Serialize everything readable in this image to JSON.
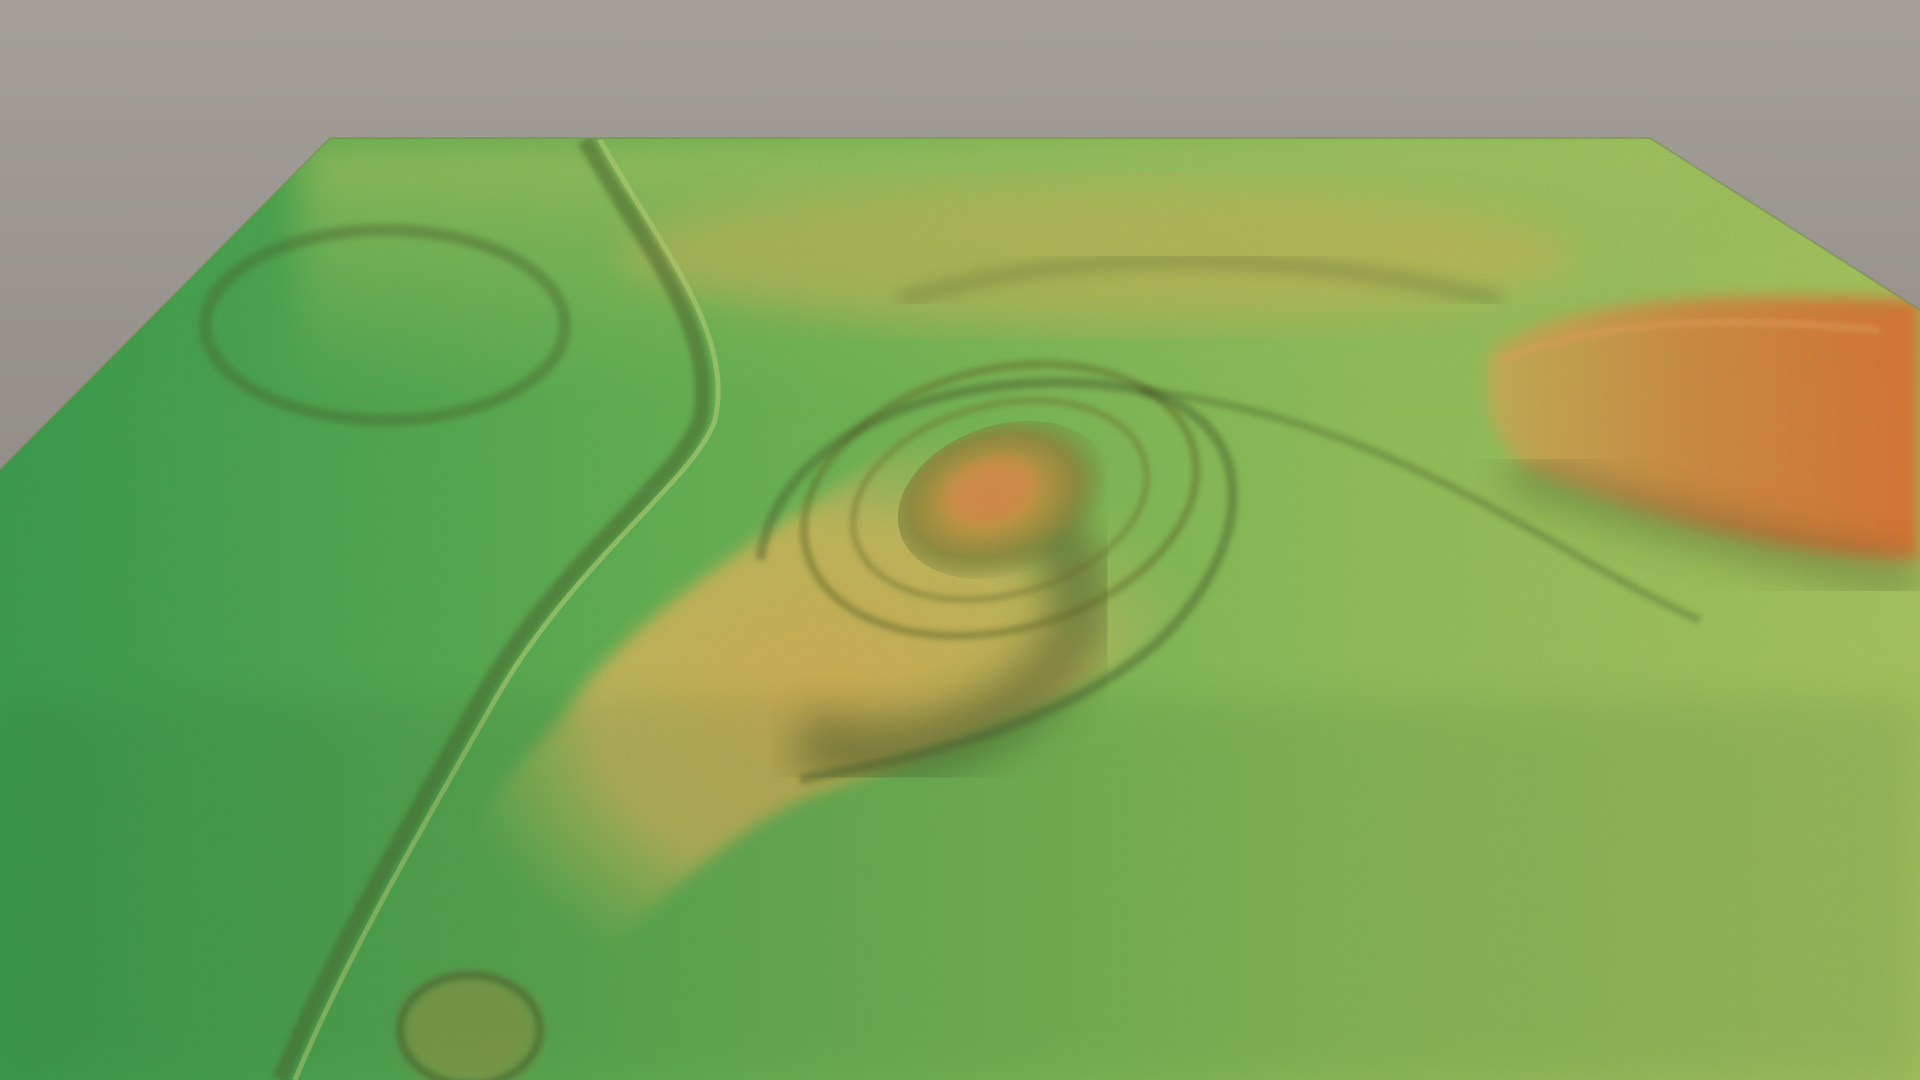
{
  "image": {
    "subject": "terrain-relief-render",
    "colors": {
      "background_top": "#a49f99",
      "background_bottom": "#7c7874",
      "terrain_low": "#2f9c4a",
      "terrain_mid": "#9ec45c",
      "terrain_high": "#d7b052",
      "terrain_peak": "#d8783a",
      "shadow": "#3a4a1f"
    }
  }
}
